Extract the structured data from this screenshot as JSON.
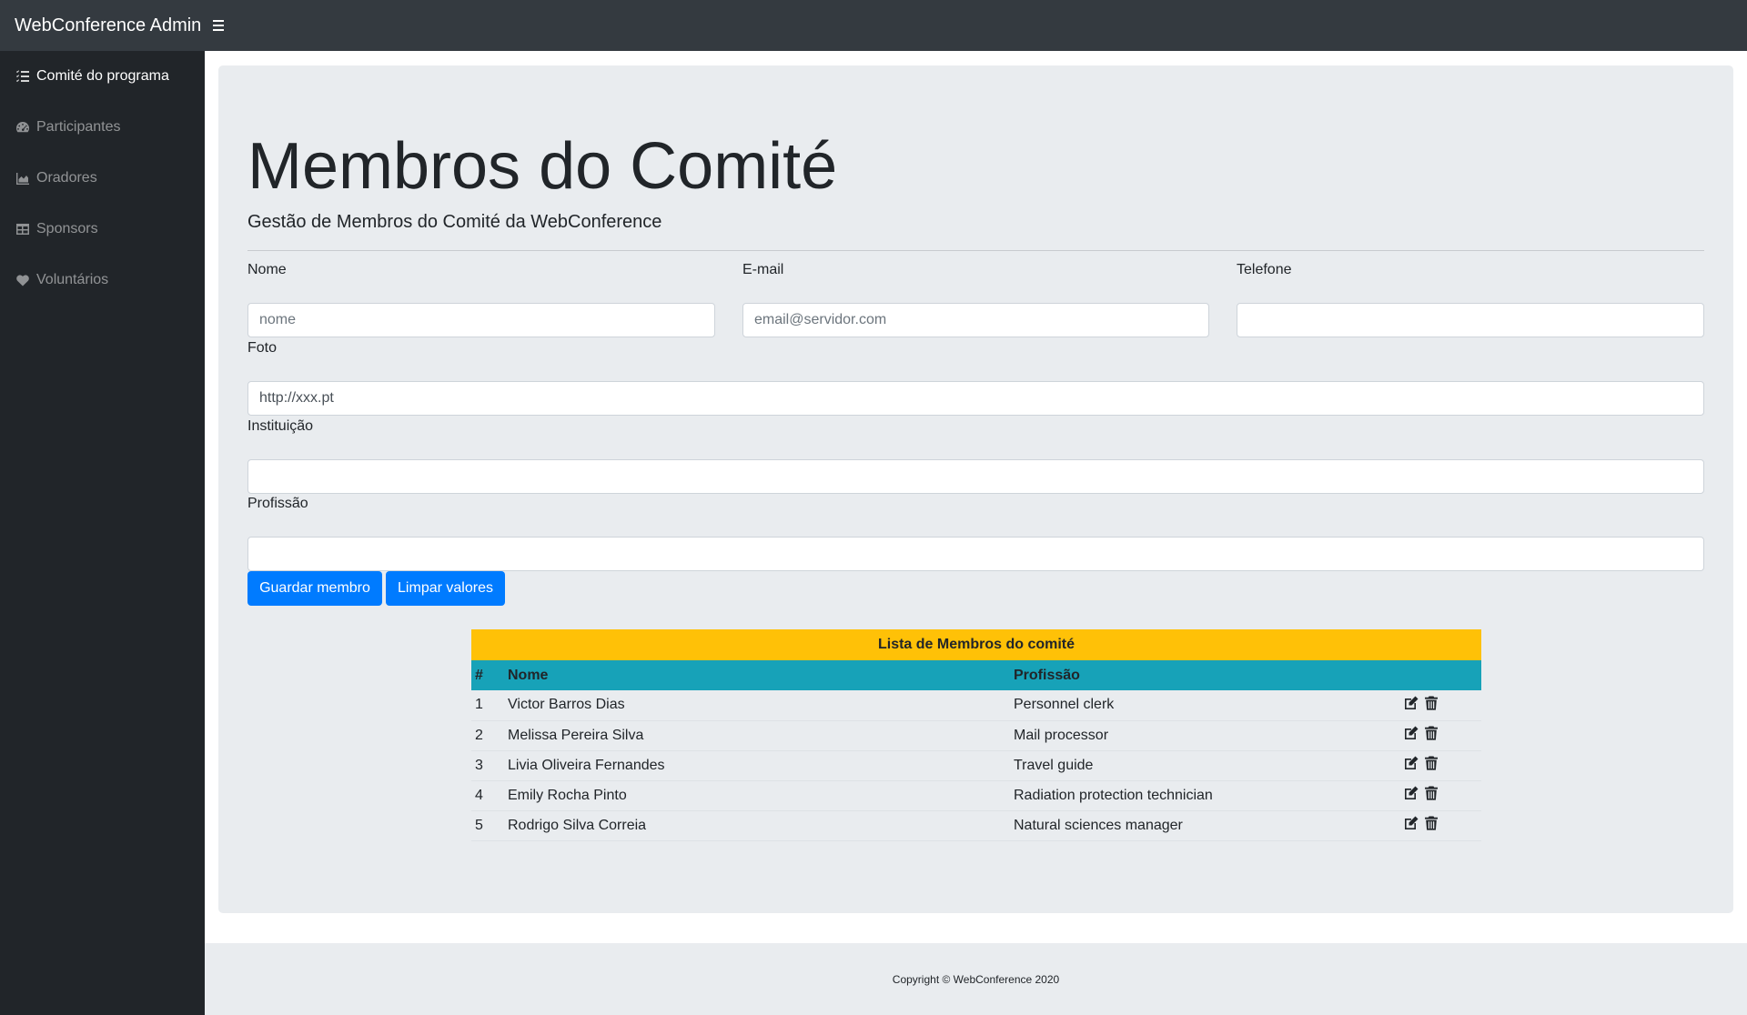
{
  "app": {
    "brand": "WebConference Admin"
  },
  "sidebar": {
    "items": [
      {
        "label": "Comité do programa",
        "icon": "list-check-icon",
        "active": true
      },
      {
        "label": "Participantes",
        "icon": "dashboard-icon",
        "active": false
      },
      {
        "label": "Oradores",
        "icon": "area-chart-icon",
        "active": false
      },
      {
        "label": "Sponsors",
        "icon": "table-icon",
        "active": false
      },
      {
        "label": "Voluntários",
        "icon": "heart-icon",
        "active": false
      }
    ]
  },
  "page": {
    "title": "Membros do Comité",
    "subtitle": "Gestão de Membros do Comité da WebConference"
  },
  "form": {
    "nome": {
      "label": "Nome",
      "placeholder": "nome",
      "value": ""
    },
    "email": {
      "label": "E-mail",
      "placeholder": "email@servidor.com",
      "value": ""
    },
    "telefone": {
      "label": "Telefone",
      "placeholder": "",
      "value": ""
    },
    "foto": {
      "label": "Foto",
      "placeholder": "",
      "value": "http://xxx.pt"
    },
    "instituicao": {
      "label": "Instituição",
      "placeholder": "",
      "value": ""
    },
    "profissao": {
      "label": "Profissão",
      "placeholder": "",
      "value": ""
    },
    "save_label": "Guardar membro",
    "clear_label": "Limpar valores"
  },
  "table": {
    "caption": "Lista de Membros do comité",
    "headers": [
      "#",
      "Nome",
      "Profissão",
      ""
    ],
    "rows": [
      {
        "num": "1",
        "nome": "Victor Barros Dias",
        "profissao": "Personnel clerk"
      },
      {
        "num": "2",
        "nome": "Melissa Pereira Silva",
        "profissao": "Mail processor"
      },
      {
        "num": "3",
        "nome": "Livia Oliveira Fernandes",
        "profissao": "Travel guide"
      },
      {
        "num": "4",
        "nome": "Emily Rocha Pinto",
        "profissao": "Radiation protection technician"
      },
      {
        "num": "5",
        "nome": "Rodrigo Silva Correia",
        "profissao": "Natural sciences manager"
      }
    ]
  },
  "footer": {
    "text": "Copyright © WebConference 2020"
  },
  "colors": {
    "topbar": "#343a40",
    "sidebar": "#212529",
    "primary": "#007bff",
    "caption": "#ffc107",
    "header": "#17a2b8",
    "jumbotron": "#e9ecef"
  }
}
